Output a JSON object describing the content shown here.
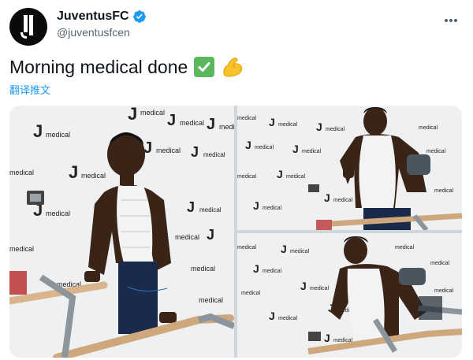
{
  "account": {
    "display_name": "JuventusFC",
    "handle": "@juventusfcen",
    "verified": true,
    "avatar_icon": "juventus-logo-icon"
  },
  "tweet": {
    "text": "Morning medical done",
    "emojis": [
      "check-mark-icon",
      "flexed-biceps-icon"
    ],
    "translate_label": "翻译推文"
  },
  "media": {
    "photos": [
      {
        "backdrop_label": "medical"
      },
      {
        "backdrop_label": "medical"
      },
      {
        "backdrop_label": "medical"
      }
    ]
  },
  "colors": {
    "link": "#1d9bf0",
    "verified": "#1d9bf0",
    "text": "#0f1419",
    "secondary": "#536471"
  }
}
